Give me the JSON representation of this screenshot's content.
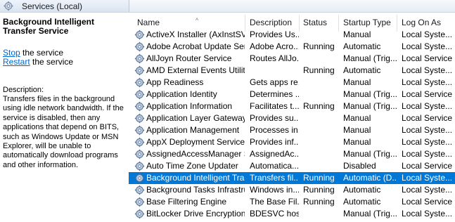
{
  "header": {
    "title": "Services (Local)",
    "icon": "services-gear-icon"
  },
  "details": {
    "service_name": "Background Intelligent Transfer Service",
    "stop_link": "Stop",
    "stop_suffix": " the service",
    "restart_link": "Restart",
    "restart_suffix": " the service",
    "description_label": "Description:",
    "description_text": "Transfers files in the background using idle network bandwidth. If the service is disabled, then any applications that depend on BITS, such as Windows Update or MSN Explorer, will be unable to automatically download programs and other information."
  },
  "columns": {
    "name": "Name",
    "description": "Description",
    "status": "Status",
    "startup": "Startup Type",
    "logon": "Log On As"
  },
  "rows": [
    {
      "name": "ActiveX Installer (AxInstSV)",
      "description": "Provides Us...",
      "status": "",
      "startup": "Manual",
      "logon": "Local Syste..."
    },
    {
      "name": "Adobe Acrobat Update Serv...",
      "description": "Adobe Acro...",
      "status": "Running",
      "startup": "Automatic",
      "logon": "Local Syste..."
    },
    {
      "name": "AllJoyn Router Service",
      "description": "Routes AllJo...",
      "status": "",
      "startup": "Manual (Trig...",
      "logon": "Local Service"
    },
    {
      "name": "AMD External Events Utility",
      "description": "",
      "status": "Running",
      "startup": "Automatic",
      "logon": "Local Syste..."
    },
    {
      "name": "App Readiness",
      "description": "Gets apps re...",
      "status": "",
      "startup": "Manual",
      "logon": "Local Syste..."
    },
    {
      "name": "Application Identity",
      "description": "Determines ...",
      "status": "",
      "startup": "Manual (Trig...",
      "logon": "Local Service"
    },
    {
      "name": "Application Information",
      "description": "Facilitates t...",
      "status": "Running",
      "startup": "Manual (Trig...",
      "logon": "Local Syste..."
    },
    {
      "name": "Application Layer Gateway ...",
      "description": "Provides su...",
      "status": "",
      "startup": "Manual",
      "logon": "Local Service"
    },
    {
      "name": "Application Management",
      "description": "Processes in...",
      "status": "",
      "startup": "Manual",
      "logon": "Local Syste..."
    },
    {
      "name": "AppX Deployment Service (...",
      "description": "Provides inf...",
      "status": "",
      "startup": "Manual",
      "logon": "Local Syste..."
    },
    {
      "name": "AssignedAccessManager Se...",
      "description": "AssignedAc...",
      "status": "",
      "startup": "Manual (Trig...",
      "logon": "Local Syste..."
    },
    {
      "name": "Auto Time Zone Updater",
      "description": "Automatica...",
      "status": "",
      "startup": "Disabled",
      "logon": "Local Service"
    },
    {
      "name": "Background Intelligent Tran...",
      "description": "Transfers fil...",
      "status": "Running",
      "startup": "Automatic (D...",
      "logon": "Local Syste...",
      "selected": true
    },
    {
      "name": "Background Tasks Infrastru...",
      "description": "Windows in...",
      "status": "Running",
      "startup": "Automatic",
      "logon": "Local Syste..."
    },
    {
      "name": "Base Filtering Engine",
      "description": "The Base Fil...",
      "status": "Running",
      "startup": "Automatic",
      "logon": "Local Service"
    },
    {
      "name": "BitLocker Drive Encryption ...",
      "description": "BDESVC hos...",
      "status": "",
      "startup": "Manual (Trig...",
      "logon": "Local Syste..."
    }
  ]
}
